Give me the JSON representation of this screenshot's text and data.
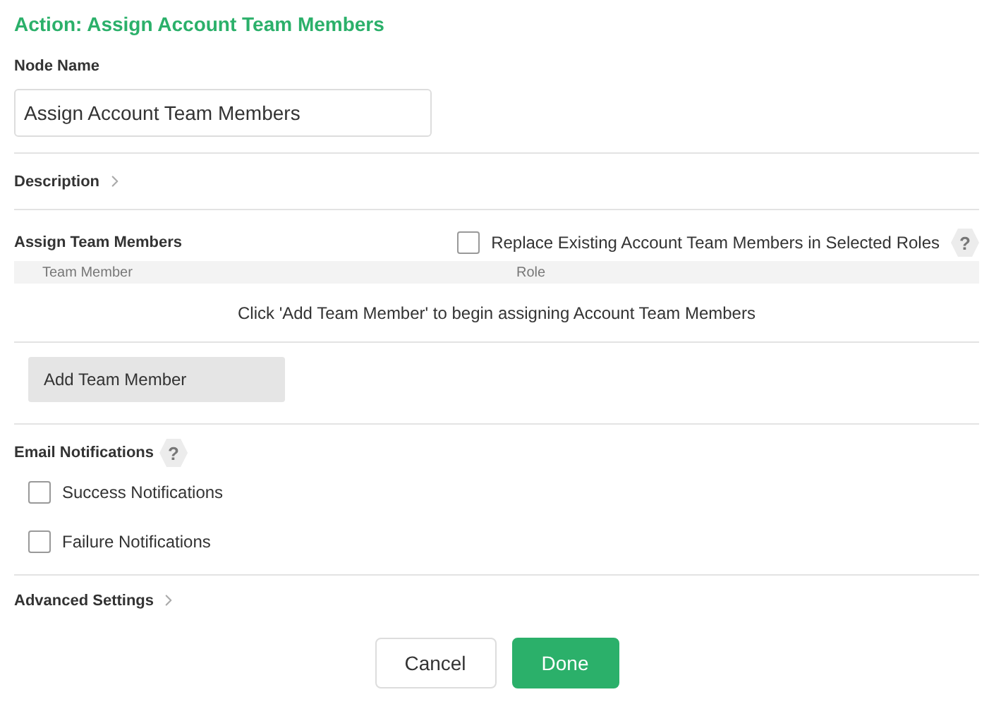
{
  "title": "Action: Assign Account Team Members",
  "node_name": {
    "label": "Node Name",
    "value": "Assign Account Team Members"
  },
  "description": {
    "label": "Description",
    "expanded": false
  },
  "assign": {
    "label": "Assign Team Members",
    "replace": {
      "label": "Replace Existing Account Team Members in Selected Roles",
      "checked": false,
      "help": "?"
    },
    "columns": [
      "Team Member",
      "Role"
    ],
    "empty_message": "Click 'Add Team Member' to begin assigning Account Team Members",
    "add_button": "Add Team Member"
  },
  "email": {
    "label": "Email Notifications",
    "help": "?",
    "options": [
      {
        "label": "Success Notifications",
        "checked": false
      },
      {
        "label": "Failure Notifications",
        "checked": false
      }
    ]
  },
  "advanced": {
    "label": "Advanced Settings",
    "expanded": false
  },
  "buttons": [
    {
      "label": "Cancel",
      "kind": "secondary"
    },
    {
      "label": "Done",
      "kind": "primary"
    }
  ]
}
